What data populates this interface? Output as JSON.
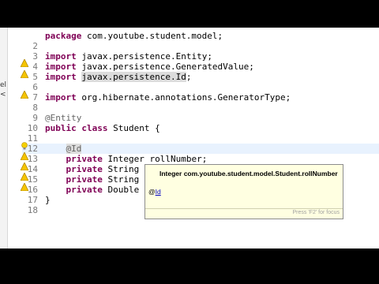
{
  "left_strip": [
    "el",
    "<"
  ],
  "editor": {
    "lines": [
      {
        "num": "",
        "html": "<span class=\"kw\">package</span> com.youtube.student.model;"
      },
      {
        "num": "2",
        "html": ""
      },
      {
        "num": "3",
        "html": "<span class=\"kw\">import</span> javax.persistence.Entity;"
      },
      {
        "num": "4",
        "html": "<span class=\"kw\">import</span> javax.persistence.GeneratedValue;"
      },
      {
        "num": "5",
        "html": "<span class=\"kw\">import</span> <span class=\"hl\">javax.persistence.Id</span>;"
      },
      {
        "num": "6",
        "html": ""
      },
      {
        "num": "7",
        "html": "<span class=\"kw\">import</span> org.hibernate.annotations.GeneratorType;"
      },
      {
        "num": "8",
        "html": ""
      },
      {
        "num": "9",
        "html": "<span class=\"ann\">@Entity</span>"
      },
      {
        "num": "10",
        "html": "<span class=\"kw\">public class</span> Student {"
      },
      {
        "num": "11",
        "html": ""
      },
      {
        "num": "12",
        "html": "    <span class=\"ann hl\">@Id</span>"
      },
      {
        "num": "13",
        "html": "    <span class=\"kw\">private</span> Integer rollNumber;"
      },
      {
        "num": "14",
        "html": "    <span class=\"kw\">private</span> String name;"
      },
      {
        "num": "15",
        "html": "    <span class=\"kw\">private</span> String address;"
      },
      {
        "num": "16",
        "html": "    <span class=\"kw\">private</span> Double percentage;"
      },
      {
        "num": "17",
        "html": "}"
      },
      {
        "num": "18",
        "html": ""
      }
    ]
  },
  "hover": {
    "title": "Integer com.youtube.student.model.Student.rollNumber",
    "annotation_prefix": "@",
    "annotation_link": "Id",
    "footer": "Press 'F2' for focus"
  },
  "colors": {
    "keyword": "#7f0055",
    "annotation": "#646464",
    "hover_bg": "#ffffe1"
  }
}
